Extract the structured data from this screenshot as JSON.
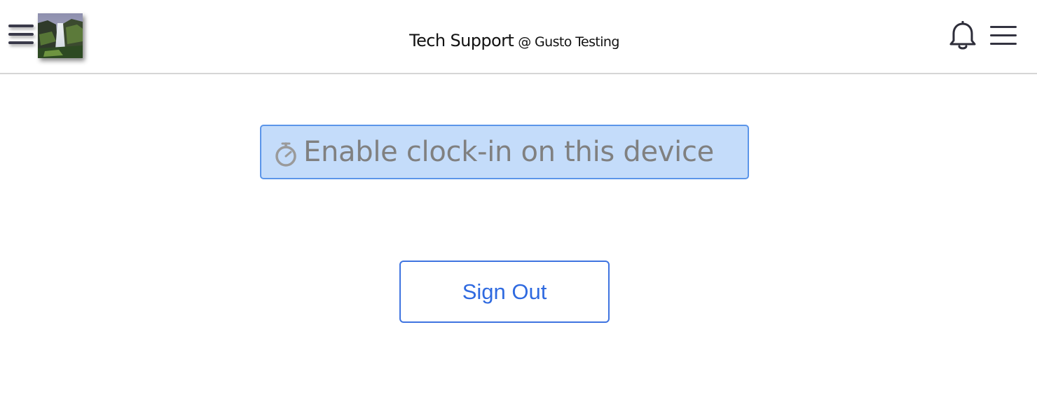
{
  "header": {
    "title": "Tech Support",
    "company": "@ Gusto Testing",
    "left_menu_icon": "hamburger-menu-icon",
    "avatar_image": "waterfall-photo",
    "notification_icon": "bell-icon",
    "right_menu_icon": "hamburger-menu-icon"
  },
  "main": {
    "clock_in_button": {
      "label": "Enable clock-in on this device",
      "icon": "stopwatch-icon",
      "background": "#c4dcfa",
      "border": "#5b95e9"
    },
    "sign_out_button": {
      "label": "Sign Out",
      "color": "#2f6ae0"
    }
  },
  "colors": {
    "accent": "#3f74e0",
    "header_divider": "#d6d6d6"
  }
}
